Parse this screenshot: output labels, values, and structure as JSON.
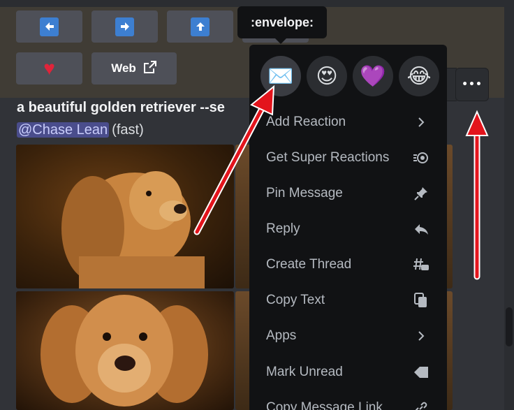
{
  "buttons": {
    "row1": [
      {
        "name": "arrow-left",
        "glyph": "🡸"
      },
      {
        "name": "arrow-right",
        "glyph": "🡺"
      },
      {
        "name": "arrow-up",
        "glyph": "🡹"
      }
    ],
    "heart_glyph": "♥",
    "web_label": "Web",
    "external_link_glyph": "⧉"
  },
  "message": {
    "prompt": "a beautiful golden retriever --se",
    "mention": "@Chase Lean",
    "speed": "(fast)"
  },
  "tooltip": {
    "text": ":envelope:"
  },
  "toolbar": {
    "more_glyph": "•••"
  },
  "reactions": [
    {
      "name": "envelope",
      "glyph": "✉️"
    },
    {
      "name": "heart-eyes",
      "glyph": "😍"
    },
    {
      "name": "purple-heart",
      "glyph": "💜"
    },
    {
      "name": "joy",
      "glyph": "😂"
    }
  ],
  "menu": {
    "items": [
      {
        "label": "Add Reaction",
        "icon": "chevron-right-icon",
        "glyph": "›"
      },
      {
        "label": "Get Super Reactions",
        "icon": "super-reaction-icon",
        "glyph": "⊜"
      },
      {
        "label": "Pin Message",
        "icon": "pin-icon",
        "glyph": "📌"
      },
      {
        "label": "Reply",
        "icon": "reply-icon",
        "glyph": "↩"
      },
      {
        "label": "Create Thread",
        "icon": "thread-icon",
        "glyph": "#"
      },
      {
        "label": "Copy Text",
        "icon": "copy-icon",
        "glyph": "⧉"
      },
      {
        "label": "Apps",
        "icon": "chevron-right-icon",
        "glyph": "›"
      },
      {
        "label": "Mark Unread",
        "icon": "mark-unread-icon",
        "glyph": "◀"
      },
      {
        "label": "Copy Message Link",
        "icon": "link-icon",
        "glyph": "🔗"
      }
    ]
  },
  "colors": {
    "background": "#313338",
    "menu": "#111214",
    "accent_arrow": "#e3141c",
    "mention_bg": "#4a4d8c"
  }
}
